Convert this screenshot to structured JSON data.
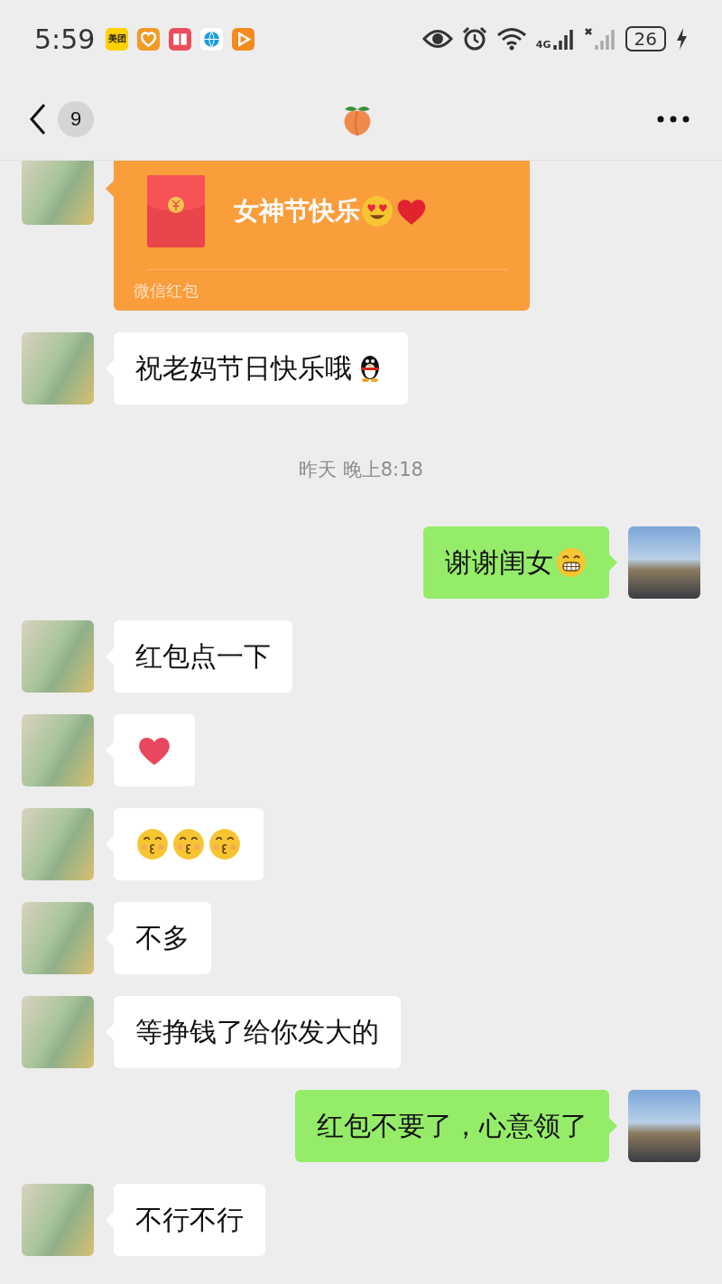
{
  "status_bar": {
    "time": "5:59",
    "apps": [
      {
        "kind": "meituan",
        "label": "美团"
      },
      {
        "kind": "heart"
      },
      {
        "kind": "book"
      },
      {
        "kind": "globe"
      },
      {
        "kind": "play"
      }
    ],
    "network": "4G",
    "battery": "26"
  },
  "header": {
    "unread": "9"
  },
  "messages": [
    {
      "kind": "red_packet",
      "outgoing": false,
      "title": "女神节快乐",
      "emojis": [
        {
          "kind": "heart-eyes"
        },
        {
          "kind": "red-heart"
        }
      ],
      "footer": "微信红包"
    },
    {
      "kind": "text",
      "outgoing": false,
      "text": "祝老妈节日快乐哦",
      "emojis": [
        {
          "kind": "penguin"
        }
      ]
    },
    {
      "kind": "time",
      "text": "昨天 晚上8:18"
    },
    {
      "kind": "text",
      "outgoing": true,
      "text": "谢谢闺女",
      "emojis": [
        {
          "kind": "grin"
        }
      ]
    },
    {
      "kind": "text",
      "outgoing": false,
      "text": "红包点一下"
    },
    {
      "kind": "text",
      "outgoing": false,
      "emojis": [
        {
          "kind": "pink-heart"
        }
      ]
    },
    {
      "kind": "text",
      "outgoing": false,
      "emojis": [
        {
          "kind": "kiss"
        },
        {
          "kind": "kiss"
        },
        {
          "kind": "kiss"
        }
      ]
    },
    {
      "kind": "text",
      "outgoing": false,
      "text": "不多"
    },
    {
      "kind": "text",
      "outgoing": false,
      "text": "等挣钱了给你发大的"
    },
    {
      "kind": "text",
      "outgoing": true,
      "text": "红包不要了，心意领了"
    },
    {
      "kind": "text",
      "outgoing": false,
      "text": "不行不行"
    }
  ]
}
